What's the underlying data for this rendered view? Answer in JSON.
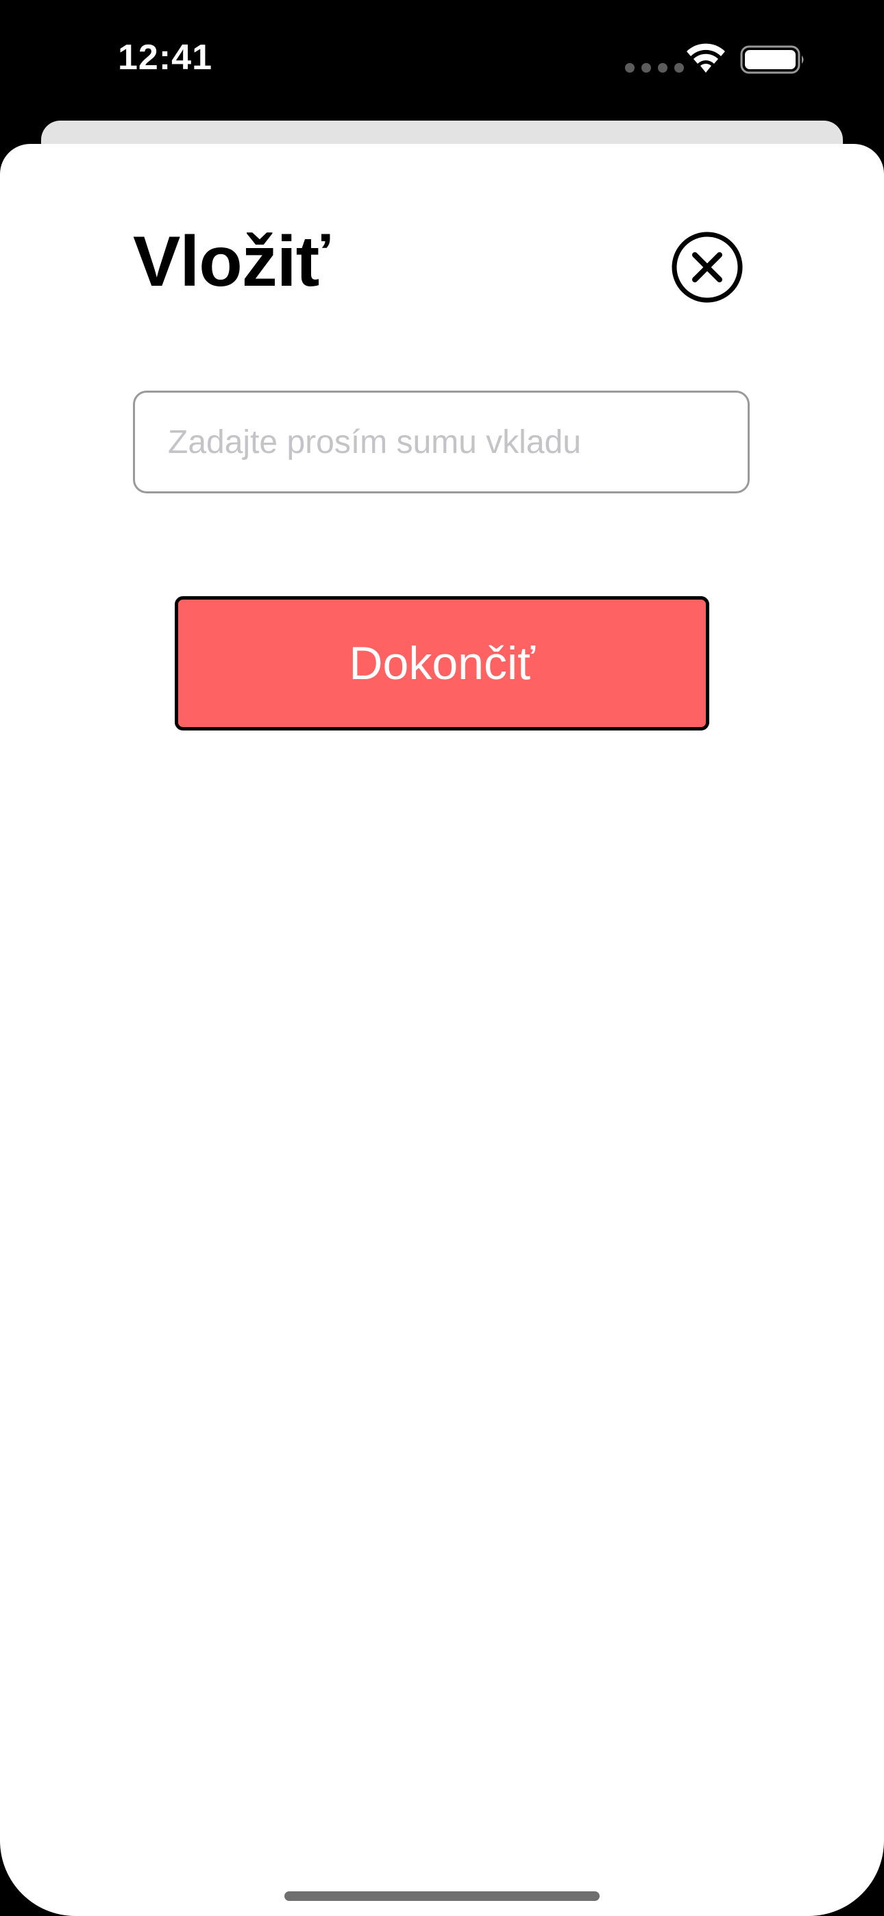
{
  "status_bar": {
    "time": "12:41",
    "signal_icon": "cellular-dots-icon",
    "wifi_icon": "wifi-icon",
    "battery_icon": "battery-icon"
  },
  "sheet": {
    "title": "Vložiť",
    "close_icon": "close-circle-icon",
    "amount_input": {
      "value": "",
      "placeholder": "Zadajte prosím sumu vkladu"
    },
    "done_button_label": "Dokončiť"
  },
  "colors": {
    "done_button_bg": "#ff6262",
    "done_button_border": "#000000",
    "background": "#000000",
    "sheet": "#ffffff"
  }
}
